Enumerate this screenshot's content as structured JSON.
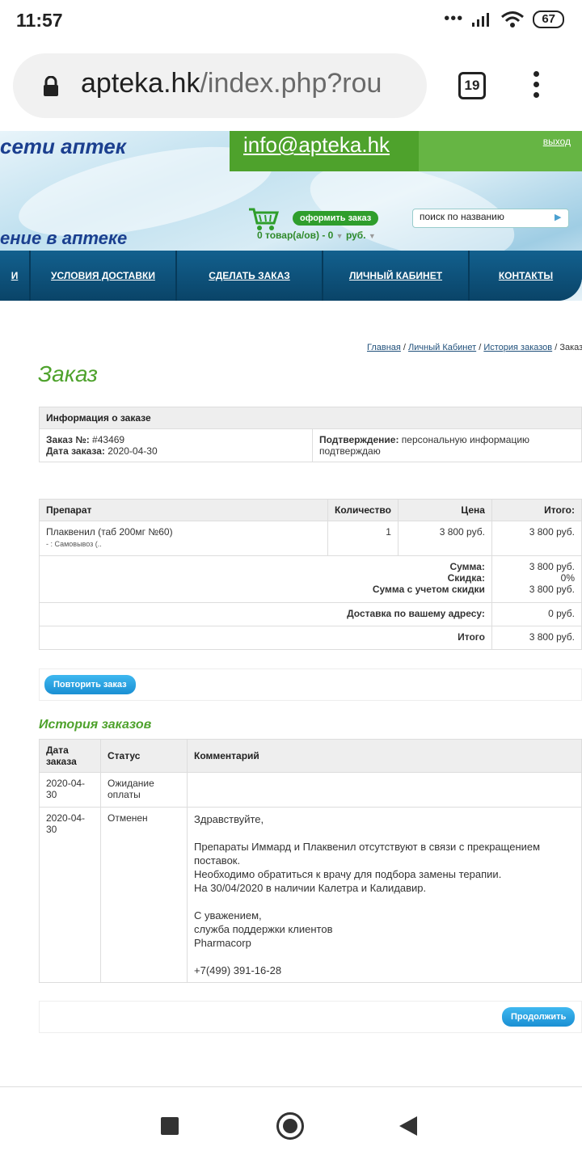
{
  "status_bar": {
    "time": "11:57",
    "signal_dots": "•••",
    "battery": "67"
  },
  "browser": {
    "url_host": "apteka.hk",
    "url_path": "/index.php?rou",
    "tabs_count": "19"
  },
  "header": {
    "slogan_top": "сети аптек",
    "slogan_bottom": "ение в аптеке",
    "email": "info@apteka.hk",
    "logout": "выход",
    "checkout_button": "оформить заказ",
    "cart_summary": "0 товар(а/ов) - 0",
    "cart_currency": "руб.",
    "search_placeholder": "поиск по названию"
  },
  "nav": [
    {
      "label": "И"
    },
    {
      "label": "УСЛОВИЯ ДОСТАВКИ"
    },
    {
      "label": "СДЕЛАТЬ ЗАКАЗ"
    },
    {
      "label": "ЛИЧНЫЙ КАБИНЕТ"
    },
    {
      "label": "КОНТАКТЫ"
    }
  ],
  "breadcrumb": {
    "home": "Главная",
    "cabinet": "Личный Кабинет",
    "history": "История заказов",
    "current": "Заказ"
  },
  "page_title": "Заказ",
  "order_info": {
    "header": "Информация о заказе",
    "number_label": "Заказ №:",
    "number_value": "#43469",
    "date_label": "Дата заказа:",
    "date_value": "2020-04-30",
    "confirm_label": "Подтверждение:",
    "confirm_value": "персональную информацию подтверждаю"
  },
  "products": {
    "headers": [
      "Препарат",
      "Количество",
      "Цена",
      "Итого:"
    ],
    "rows": [
      {
        "name": "Плаквенил (таб 200мг №60)",
        "note": "- : Самовывоз (..",
        "qty": "1",
        "price": "3 800 руб.",
        "total": "3 800 руб."
      }
    ],
    "sum_label": "Сумма:",
    "sum_value": "3 800 руб.",
    "discount_label": "Скидка:",
    "discount_value": "0%",
    "sum_discount_label": "Сумма с учетом скидки",
    "sum_discount_value": "3 800 руб.",
    "delivery_label": "Доставка по вашему адресу:",
    "delivery_value": "0 руб.",
    "grand_label": "Итого",
    "grand_value": "3 800 руб."
  },
  "repeat_button": "Повторить заказ",
  "history": {
    "title": "История заказов",
    "headers": [
      "Дата заказа",
      "Статус",
      "Комментарий"
    ],
    "rows": [
      {
        "date": "2020-04-30",
        "status": "Ожидание оплаты",
        "comment": ""
      },
      {
        "date": "2020-04-30",
        "status": "Отменен",
        "comment": "Здравствуйте,\n\nПрепараты Иммард и Плаквенил отсутствуют в связи с прекращением поставок.\nНеобходимо обратиться к врачу для подбора замены терапии.\nНа 30/04/2020 в наличии Калетра и Калидавир.\n\nС уважением,\nслужба поддержки клиентов\nPharmacorp\n\n+7(499) 391-16-28"
      }
    ]
  },
  "continue_button": "Продолжить"
}
